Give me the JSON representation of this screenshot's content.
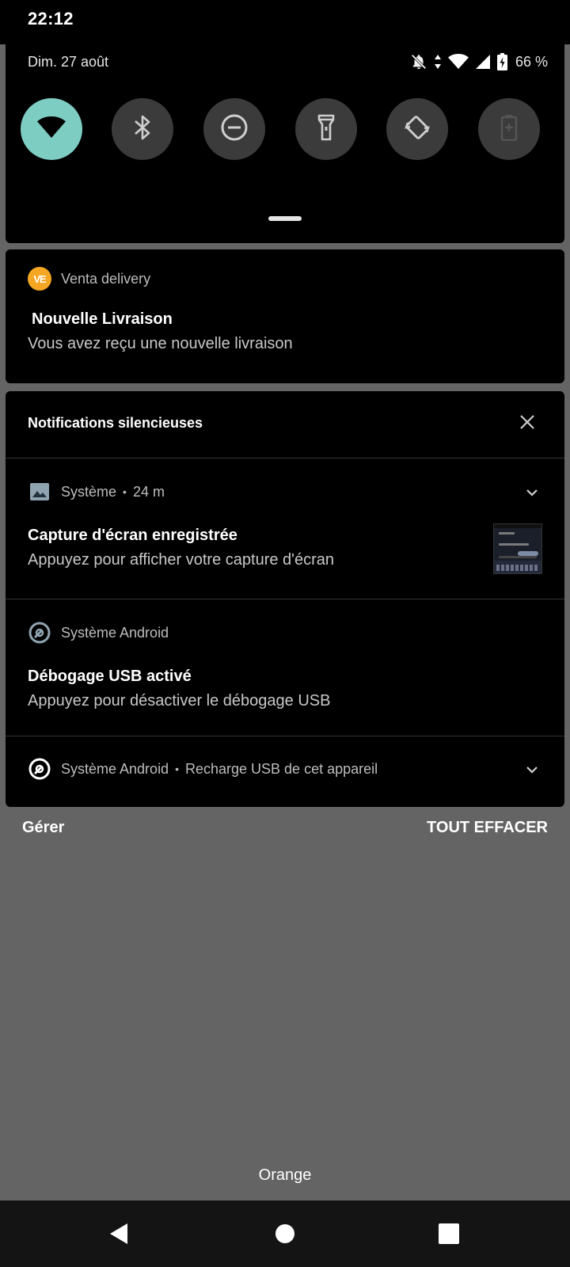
{
  "status_bar": {
    "time": "22:12"
  },
  "quick_settings": {
    "date": "Dim. 27 août",
    "battery_percent": "66 %",
    "tiles": [
      {
        "icon": "wifi-icon",
        "active": true
      },
      {
        "icon": "bluetooth-icon",
        "active": false
      },
      {
        "icon": "do-not-disturb-icon",
        "active": false
      },
      {
        "icon": "flashlight-icon",
        "active": false
      },
      {
        "icon": "auto-rotate-icon",
        "active": false
      },
      {
        "icon": "battery-saver-icon",
        "active": false
      }
    ],
    "colors": {
      "active_tile": "#7ecdc2",
      "inactive_tile": "#3b3b3b"
    }
  },
  "notifications": {
    "alerting": {
      "app_logo_text": "VE",
      "app_name": "Venta delivery",
      "title": "Nouvelle Livraison",
      "text": "Vous avez reçu une nouvelle livraison",
      "logo_color": "#f5a623"
    },
    "silent_section": {
      "header": "Notifications silencieuses",
      "items": [
        {
          "app_name": "Système",
          "separator": "•",
          "time": "24 m",
          "title": "Capture d'écran enregistrée",
          "text": "Appuyez pour afficher votre capture d'écran"
        },
        {
          "app_name": "Système Android",
          "title": "Débogage USB activé",
          "text": "Appuyez pour désactiver le débogage USB"
        },
        {
          "app_name": "Système Android",
          "separator": "•",
          "summary": "Recharge USB de cet appareil"
        }
      ]
    }
  },
  "actions": {
    "manage": "Gérer",
    "clear_all": "TOUT EFFACER"
  },
  "carrier": "Orange",
  "background_color": "#646464"
}
